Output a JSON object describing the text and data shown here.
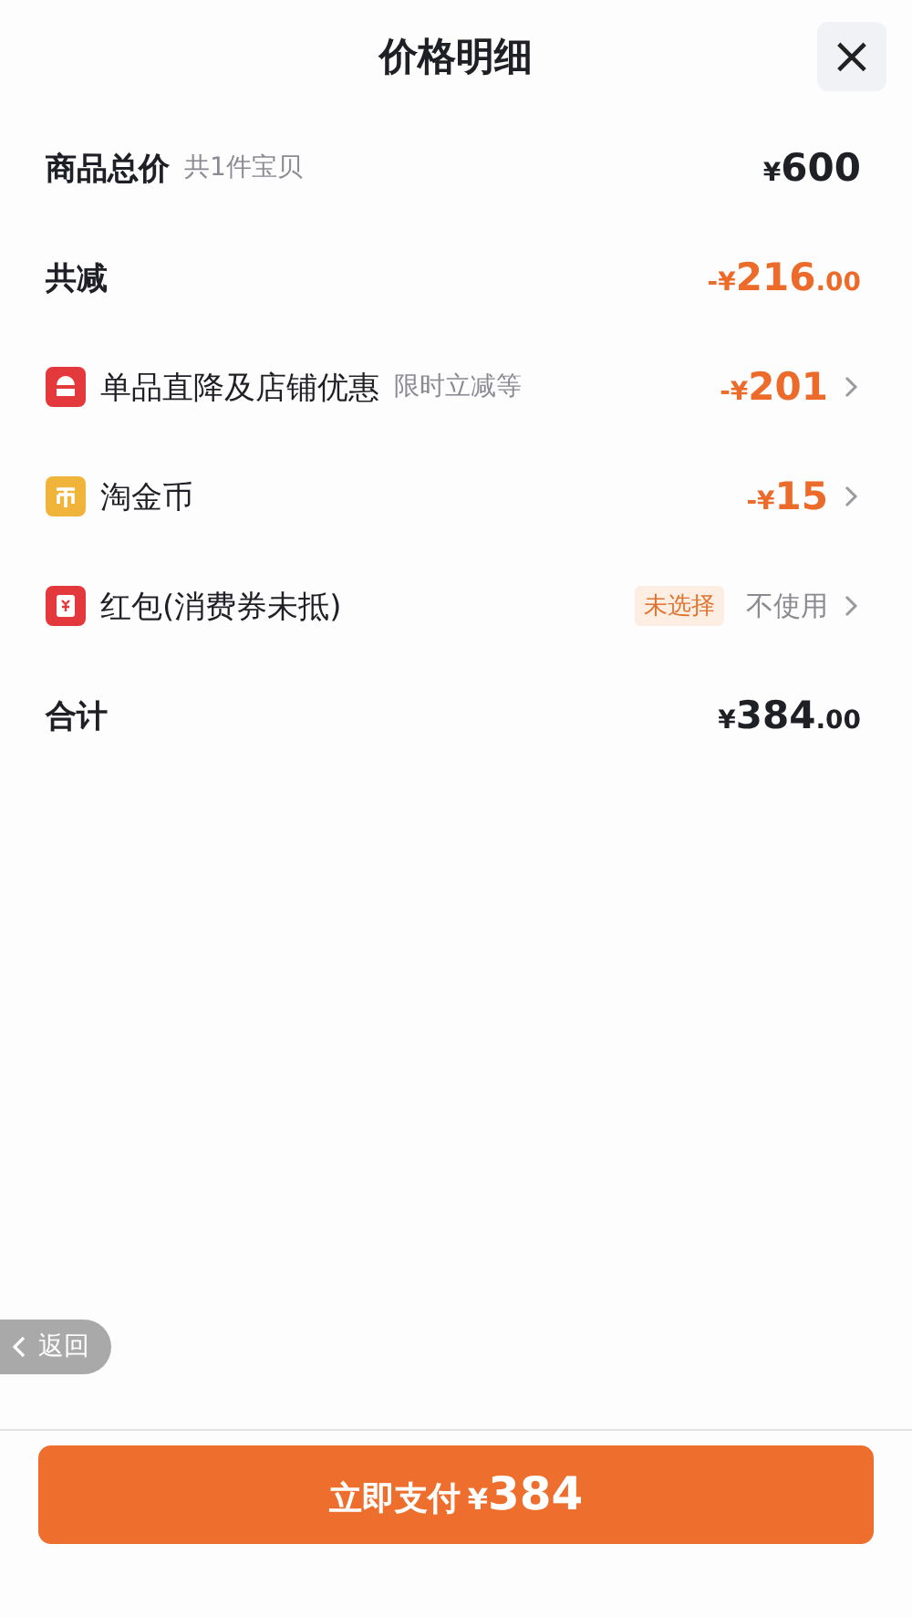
{
  "header": {
    "title": "价格明细",
    "close": "×"
  },
  "rows": [
    {
      "kind": "summary",
      "label": "商品总价",
      "note": "共1件宝贝",
      "amount": {
        "prefix": "¥",
        "main": "600"
      },
      "discount": false,
      "chevron": false
    },
    {
      "kind": "summary",
      "label": "共减",
      "amount": {
        "prefix": "-¥",
        "main": "216",
        "decimals": ".00"
      },
      "discount": true,
      "chevron": false
    },
    {
      "kind": "item",
      "label": "单品直降及店铺优惠",
      "note": "限时立减等",
      "amount": {
        "prefix": "-¥",
        "main": "201"
      },
      "discount": true,
      "chevron": true
    },
    {
      "kind": "item",
      "label": "淘金币",
      "amount": {
        "prefix": "-¥",
        "main": "15"
      },
      "discount": true,
      "chevron": true
    },
    {
      "kind": "item",
      "label": "红包(消费券未抵)",
      "tag": "未选择",
      "value": "不使用",
      "chevron": true
    },
    {
      "kind": "summary",
      "label": "合计",
      "amount": {
        "prefix": "¥",
        "main": "384",
        "decimals": ".00"
      },
      "discount": false,
      "chevron": false
    }
  ],
  "back_button": "返回",
  "pay_button": {
    "label": "立即支付",
    "prefix": "¥",
    "amount": "384"
  }
}
